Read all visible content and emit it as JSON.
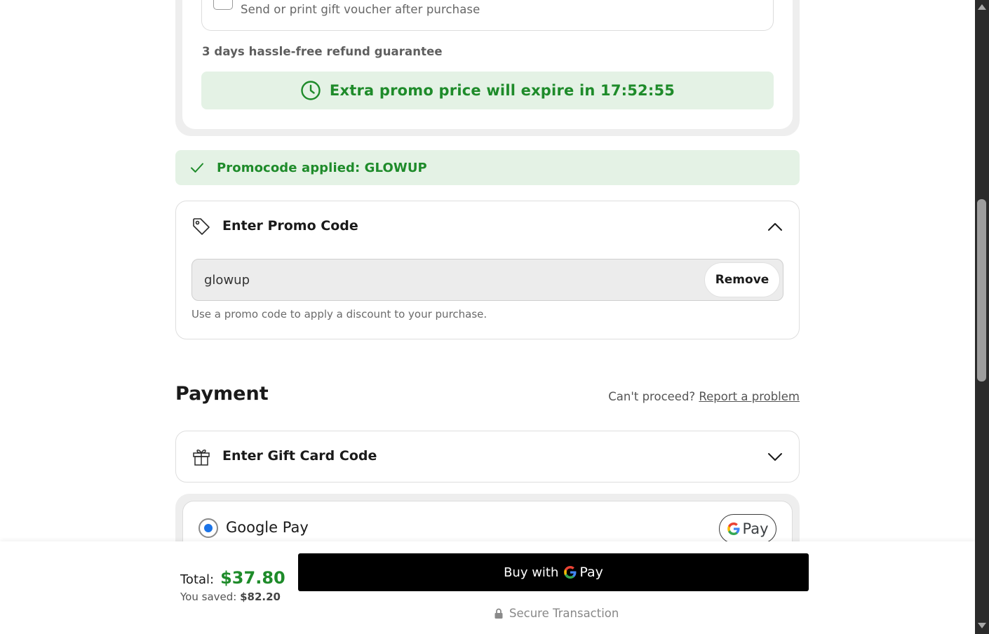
{
  "order": {
    "gift_voucher_label": "Send or print gift voucher after purchase",
    "refund_guarantee": "3 days hassle-free refund guarantee",
    "expire_banner": "Extra promo price will expire in 17:52:55"
  },
  "promo_applied": {
    "text": "Promocode applied: GLOWUP"
  },
  "promo_code": {
    "title": "Enter Promo Code",
    "input_value": "glowup",
    "remove_label": "Remove",
    "help_text": "Use a promo code to apply a discount to your purchase."
  },
  "payment": {
    "title": "Payment",
    "cant_proceed": "Can't proceed?",
    "report_link": "Report a problem",
    "gift_card_title": "Enter Gift Card Code",
    "method_label": "Google Pay",
    "badge_pay": "Pay"
  },
  "summary": {
    "total_label": "Total:",
    "total_value": "$37.80",
    "saved_label": "You saved:",
    "saved_value": "$82.20",
    "buy_prefix": "Buy with",
    "buy_pay": "Pay",
    "secure_text": "Secure Transaction"
  },
  "colors": {
    "accent_green": "#1e8b2a",
    "banner_green_bg": "#e4f2e5",
    "radio_blue": "#1a73e8"
  },
  "icons": [
    "checkbox-icon",
    "clock-icon",
    "check-icon",
    "tag-icon",
    "chevron-up-icon",
    "gift-icon",
    "chevron-down-icon",
    "google-g-icon",
    "lock-icon"
  ]
}
